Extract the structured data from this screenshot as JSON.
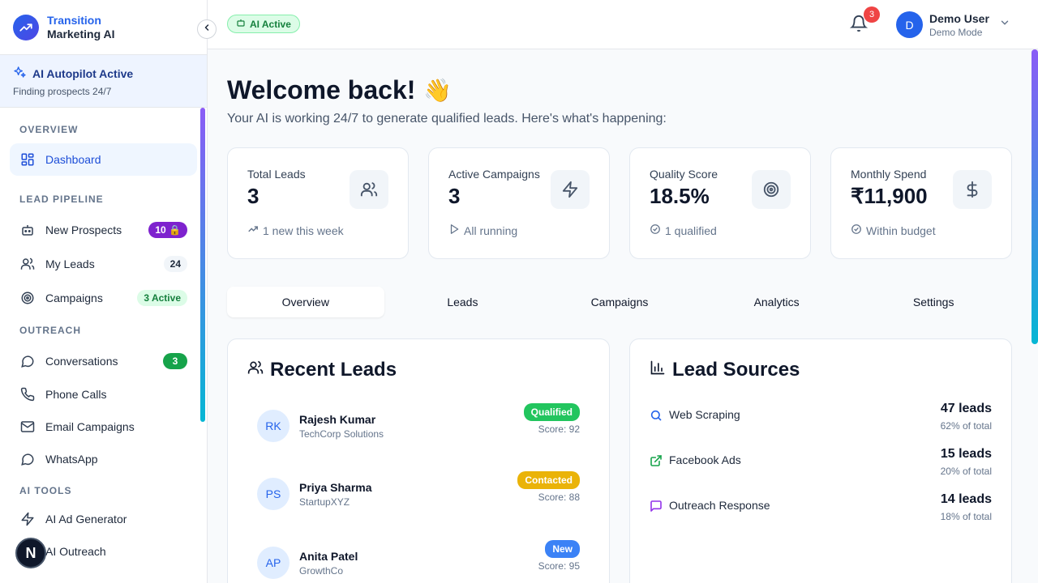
{
  "brand": {
    "line1": "Transition",
    "line2": "Marketing AI"
  },
  "autopilot": {
    "title": "AI Autopilot Active",
    "subtitle": "Finding prospects 24/7"
  },
  "nav": {
    "overview_label": "OVERVIEW",
    "dashboard": "Dashboard",
    "pipeline_label": "LEAD PIPELINE",
    "new_prospects": {
      "label": "New Prospects",
      "badge": "10 🔒"
    },
    "my_leads": {
      "label": "My Leads",
      "badge": "24"
    },
    "campaigns": {
      "label": "Campaigns",
      "badge": "3 Active"
    },
    "outreach_label": "OUTREACH",
    "conversations": {
      "label": "Conversations",
      "badge": "3"
    },
    "phone_calls": "Phone Calls",
    "email_campaigns": "Email Campaigns",
    "whatsapp": "WhatsApp",
    "ai_tools_label": "AI TOOLS",
    "ai_ad_generator": "AI Ad Generator",
    "ai_outreach": "AI Outreach",
    "fab_letter": "N"
  },
  "header": {
    "ai_status": "AI Active",
    "notifications": "3",
    "user_initial": "D",
    "user_name": "Demo User",
    "user_mode": "Demo Mode"
  },
  "main": {
    "welcome": "Welcome back!",
    "wave": "👋",
    "subtitle": "Your AI is working 24/7 to generate qualified leads. Here's what's happening:"
  },
  "stats": [
    {
      "label": "Total Leads",
      "value": "3",
      "foot": "1 new this week",
      "icon": "users-icon"
    },
    {
      "label": "Active Campaigns",
      "value": "3",
      "foot": "All running",
      "icon": "zap-icon"
    },
    {
      "label": "Quality Score",
      "value": "18.5%",
      "foot": "1 qualified",
      "icon": "target-icon"
    },
    {
      "label": "Monthly Spend",
      "value": "₹11,900",
      "foot": "Within budget",
      "icon": "dollar-icon"
    }
  ],
  "tabs": [
    "Overview",
    "Leads",
    "Campaigns",
    "Analytics",
    "Settings"
  ],
  "recent_leads": {
    "title": "Recent Leads",
    "items": [
      {
        "initials": "RK",
        "name": "Rajesh Kumar",
        "company": "TechCorp Solutions",
        "status": "Qualified",
        "status_color": "#22c55e",
        "score": "Score: 92"
      },
      {
        "initials": "PS",
        "name": "Priya Sharma",
        "company": "StartupXYZ",
        "status": "Contacted",
        "status_color": "#eab308",
        "score": "Score: 88"
      },
      {
        "initials": "AP",
        "name": "Anita Patel",
        "company": "GrowthCo",
        "status": "New",
        "status_color": "#3b82f6",
        "score": "Score: 95"
      }
    ]
  },
  "lead_sources": {
    "title": "Lead Sources",
    "items": [
      {
        "name": "Web Scraping",
        "count": "47 leads",
        "pct": "62% of total",
        "icon": "search-icon",
        "color": "#2563eb"
      },
      {
        "name": "Facebook Ads",
        "count": "15 leads",
        "pct": "20% of total",
        "icon": "external-link-icon",
        "color": "#16a34a"
      },
      {
        "name": "Outreach Response",
        "count": "14 leads",
        "pct": "18% of total",
        "icon": "message-icon",
        "color": "#9333ea"
      }
    ]
  }
}
